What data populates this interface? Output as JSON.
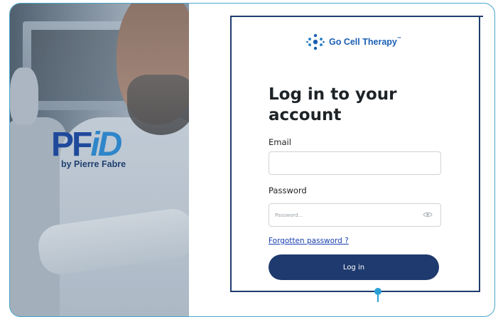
{
  "hero": {
    "logo_main": "PF",
    "logo_accent": "iD",
    "logo_sub": "by Pierre Fabre"
  },
  "brand": {
    "name": "Go Cell Therapy",
    "trademark": "™",
    "icon": "molecule-dots-icon"
  },
  "form": {
    "title": "Log in to your account",
    "email_label": "Email",
    "email_value": "",
    "email_placeholder": "",
    "password_label": "Password",
    "password_placeholder": "Password...",
    "password_toggle_icon": "eye-icon",
    "forgot_link": "Forgotten password ?",
    "submit_label": "Log in"
  },
  "colors": {
    "accent": "#1e3a6e",
    "frame_border": "#49a6c9",
    "link": "#1a3fb0",
    "brand_blue": "#1b5fb3"
  }
}
